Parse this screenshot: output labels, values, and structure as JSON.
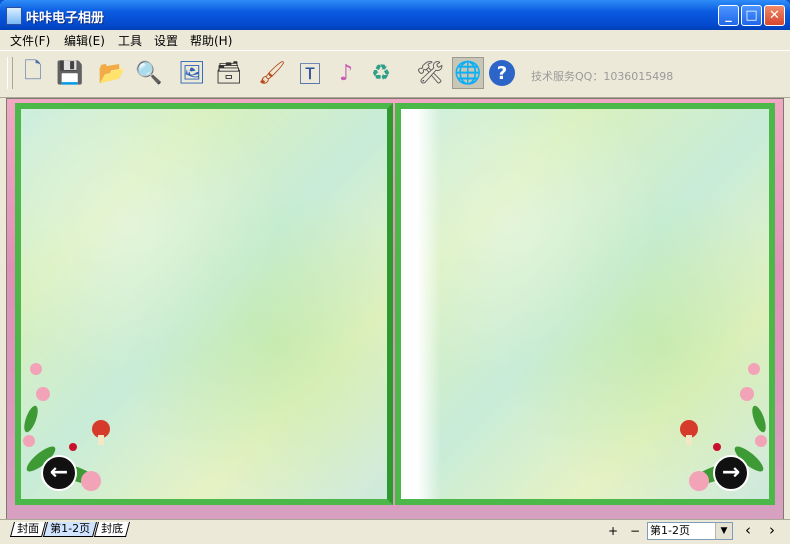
{
  "window": {
    "title": "咔咔电子相册",
    "controls": {
      "minimize": "_",
      "maximize": "□",
      "close": "✕"
    }
  },
  "menu": [
    {
      "label": "文件(F)"
    },
    {
      "label": "编辑(E)"
    },
    {
      "label": "工具"
    },
    {
      "label": "设置"
    },
    {
      "label": "帮助(H)"
    }
  ],
  "toolbar": {
    "tools": [
      {
        "name": "new-icon",
        "glyph": "🗋"
      },
      {
        "name": "save-icon",
        "glyph": "💾"
      },
      {
        "name": "open-folder-icon",
        "glyph": "📂"
      },
      {
        "name": "zoom-icon",
        "glyph": "🔍"
      },
      {
        "name": "edit-image-icon",
        "glyph": "🖼"
      },
      {
        "name": "frame-edit-icon",
        "glyph": "🗃"
      },
      {
        "name": "brush-icon",
        "glyph": "🖌"
      },
      {
        "name": "text-icon",
        "glyph": "🅃"
      },
      {
        "name": "music-icon",
        "glyph": "♪"
      },
      {
        "name": "recycle-icon",
        "glyph": "♻"
      },
      {
        "name": "settings-icon",
        "glyph": "🛠"
      },
      {
        "name": "web-icon",
        "glyph": "🌐"
      },
      {
        "name": "help-icon",
        "glyph": "?"
      }
    ],
    "support_text": "技术服务QQ：1036015498"
  },
  "album": {
    "prev_glyph": "←",
    "next_glyph": "→"
  },
  "status": {
    "tabs": [
      {
        "label": "封面"
      },
      {
        "label": "第1-2页"
      },
      {
        "label": "封底"
      }
    ],
    "plus": "+",
    "minus": "−",
    "page_select": "第1-2页",
    "nav_prev": "‹",
    "nav_next": "›"
  }
}
